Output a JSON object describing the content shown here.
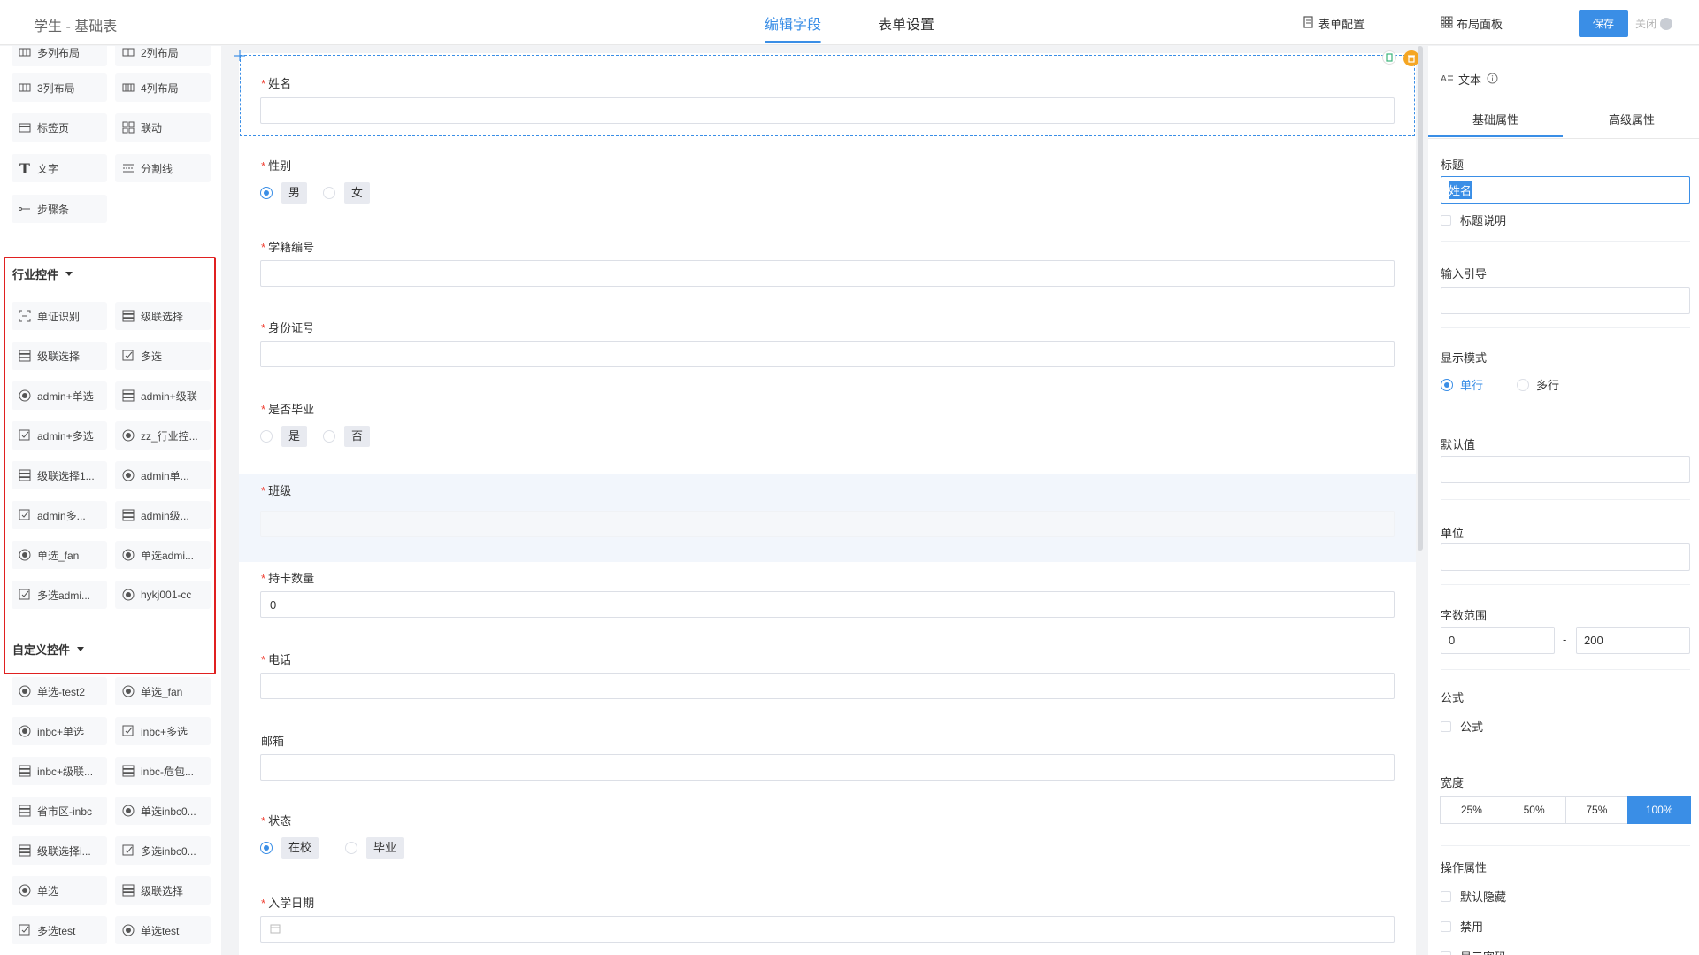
{
  "app": {
    "title": "学生 - 基础表"
  },
  "header": {
    "tabs": [
      {
        "label": "编辑字段",
        "active": true
      },
      {
        "label": "表单设置",
        "active": false
      }
    ],
    "form_config": "表单配置",
    "layout_panel": "布局面板",
    "save": "保存",
    "close": "关闭"
  },
  "left": {
    "layout_items": [
      "多列布局",
      "2列布局",
      "3列布局",
      "4列布局",
      "标签页",
      "联动",
      "文字",
      "分割线",
      "步骤条"
    ],
    "industry": {
      "title": "行业控件",
      "items": [
        "单证识别",
        "级联选择",
        "级联选择",
        "多选",
        "admin+单选",
        "admin+级联",
        "admin+多选",
        "zz_行业控...",
        "级联选择1...",
        "admin单...",
        "admin多...",
        "admin级...",
        "单选_fan",
        "单选admi...",
        "多选admi...",
        "hykj001-cc"
      ]
    },
    "custom": {
      "title": "自定义控件",
      "items": [
        "单选-test2",
        "单选_fan",
        "inbc+单选",
        "inbc+多选",
        "inbc+级联...",
        "inbc-危包...",
        "省市区-inbc",
        "单选inbc0...",
        "级联选择i...",
        "多选inbc0...",
        "单选",
        "级联选择",
        "多选test",
        "单选test"
      ]
    }
  },
  "form": {
    "fields": {
      "name": {
        "label": "姓名",
        "required": true
      },
      "gender": {
        "label": "性别",
        "options": [
          "男",
          "女"
        ],
        "selected": "男"
      },
      "student_no": {
        "label": "学籍编号"
      },
      "id_card": {
        "label": "身份证号"
      },
      "graduated": {
        "label": "是否毕业",
        "options": [
          "是",
          "否"
        ]
      },
      "class": {
        "label": "班级"
      },
      "card_count": {
        "label": "持卡数量",
        "value": "0"
      },
      "phone": {
        "label": "电话"
      },
      "email": {
        "label": "邮箱"
      },
      "status": {
        "label": "状态",
        "options": [
          "在校",
          "毕业"
        ],
        "selected": "在校"
      },
      "enroll_date": {
        "label": "入学日期"
      }
    }
  },
  "right": {
    "header": "文本",
    "tabs": [
      "基础属性",
      "高级属性"
    ],
    "title_label": "标题",
    "title_value": "姓名",
    "title_desc": "标题说明",
    "input_guide": "输入引导",
    "display_mode": "显示模式",
    "display_options": [
      "单行",
      "多行"
    ],
    "default_value": "默认值",
    "unit": "单位",
    "char_range": "字数范围",
    "char_min": "0",
    "char_sep": "-",
    "char_max": "200",
    "formula_label": "公式",
    "formula_check": "公式",
    "width_label": "宽度",
    "width_options": [
      "25%",
      "50%",
      "75%",
      "100%"
    ],
    "width_selected": "100%",
    "ops_label": "操作属性",
    "ops": [
      "默认隐藏",
      "禁用",
      "显示密码"
    ]
  },
  "colors": {
    "accent": "#3a8ee6",
    "required": "#f04134",
    "highlight": "#e02020"
  }
}
